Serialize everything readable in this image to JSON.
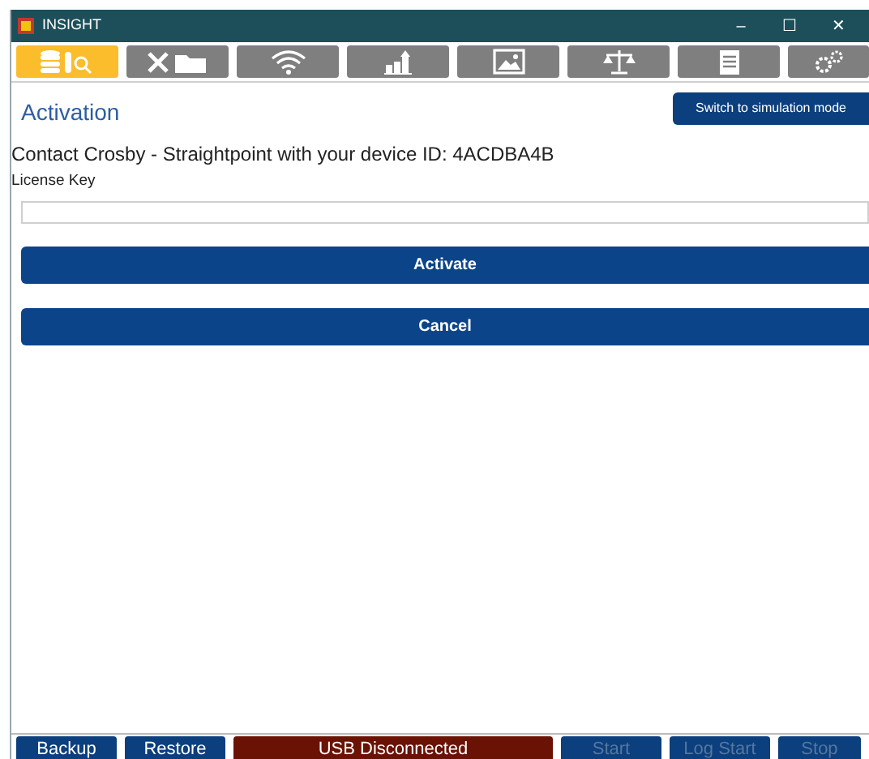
{
  "window": {
    "title": "INSIGHT",
    "controls": [
      "–",
      "☐",
      "✕"
    ]
  },
  "tabs": [
    {
      "selected": true
    },
    {
      "selected": false
    },
    {
      "selected": false
    },
    {
      "selected": false
    },
    {
      "selected": false
    },
    {
      "selected": false
    },
    {
      "selected": false
    },
    {
      "selected": false
    }
  ],
  "page": {
    "title": "Activation",
    "mode_button": "Switch to simulation mode",
    "message": "Contact Crosby - Straightpoint with your device ID: 4ACDBA4B",
    "field_label": "License Key"
  },
  "actions": [
    "Activate",
    "Cancel"
  ],
  "status_bar": [
    {
      "label": "Backup",
      "kind": "button",
      "disabled": false
    },
    {
      "label": "Restore",
      "kind": "button",
      "disabled": false
    },
    {
      "label": "USB Disconnected",
      "kind": "status",
      "disabled": false
    },
    {
      "label": "Start",
      "kind": "button",
      "disabled": true
    },
    {
      "label": "Log Start",
      "kind": "button",
      "disabled": true
    },
    {
      "label": "Stop",
      "kind": "button",
      "disabled": true
    }
  ]
}
